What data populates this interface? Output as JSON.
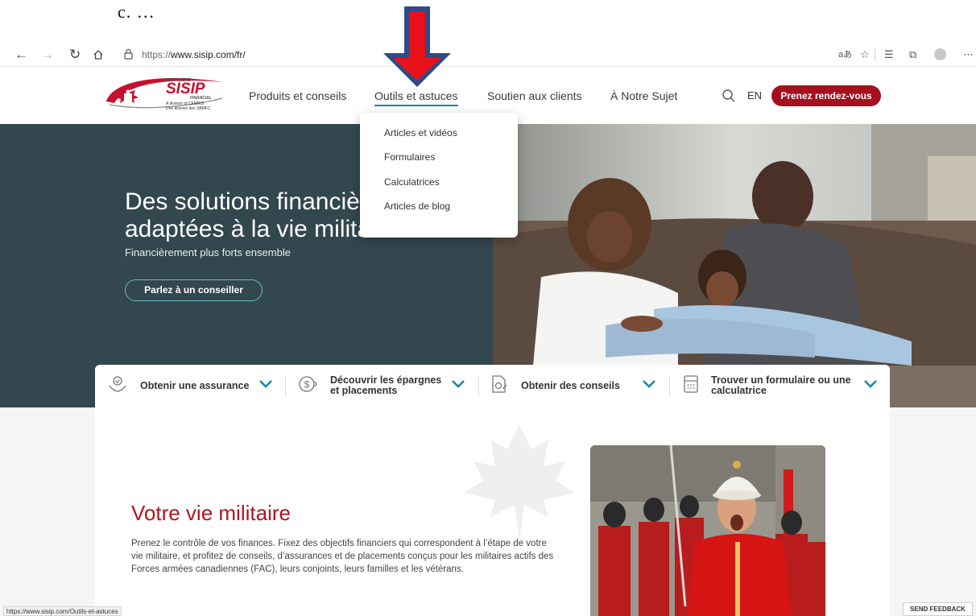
{
  "caption": "c.  …",
  "browser": {
    "url_scheme": "https://",
    "url_host": "www.sisip.com/fr/"
  },
  "logo": {
    "top_word": "FINANCIÈRE",
    "brand": "SISIP",
    "sub_word": "FINANCIAL",
    "division_en": "A division of CFMWS",
    "division_fr": "Une division des SBMFC"
  },
  "nav": {
    "items": [
      "Produits et conseils",
      "Outils et astuces",
      "Soutien aux clients",
      "À Notre Sujet"
    ],
    "lang": "EN",
    "cta": "Prenez rendez-vous"
  },
  "dropdown": {
    "items": [
      "Articles et vidéos",
      "Formulaires",
      "Calculatrices",
      "Articles de blog"
    ]
  },
  "hero": {
    "title_line1": "Des solutions financières",
    "title_line2": "adaptées à la vie militaire",
    "subtitle": "Financièrement plus forts ensemble",
    "button": "Parlez à un conseiller"
  },
  "quick_bar": {
    "items": [
      {
        "line1": "Obtenir une assurance",
        "line2": ""
      },
      {
        "line1": "Découvrir les épargnes",
        "line2": "et placements"
      },
      {
        "line1": "Obtenir des conseils",
        "line2": ""
      },
      {
        "line1": "Trouver un formulaire ou une",
        "line2": "calculatrice"
      }
    ]
  },
  "section": {
    "title": "Votre vie militaire",
    "body": "Prenez le contrôle de vos finances. Fixez des objectifs financiers qui correspondent à l’étape de votre vie militaire, et profitez de conseils, d’assurances et de placements conçus pour les militaires actifs des Forces armées canadiennes (FAC), leurs conjoints, leurs familles et les vétérans."
  },
  "status_url": "https://www.sisip.com/Outils-et-astuces",
  "feedback": "SEND FEEDBACK",
  "colors": {
    "brand_red": "#a50f1e",
    "hero_bg": "#32474e",
    "accent_teal": "#1a8aa3",
    "title_red": "#b3141f"
  }
}
